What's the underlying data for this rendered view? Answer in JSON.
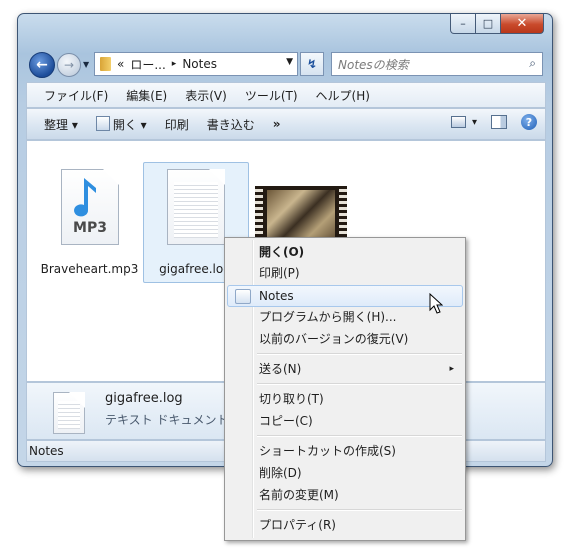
{
  "window": {
    "minimize": "–",
    "maximize": "□",
    "close": "✕"
  },
  "nav": {
    "back": "←",
    "forward": "→",
    "dropdown": "▼"
  },
  "address": {
    "chevrons": "«",
    "crumb1": "ロー...",
    "sep": "▸",
    "crumb2": "Notes",
    "drop": "▼"
  },
  "refresh": "↯",
  "search": {
    "placeholder": "Notesの検索",
    "icon": "⌕"
  },
  "menubar": [
    "ファイル(F)",
    "編集(E)",
    "表示(V)",
    "ツール(T)",
    "ヘルプ(H)"
  ],
  "toolbar": {
    "organize": "整理 ▾",
    "open": "開く ▾",
    "print": "印刷",
    "burn": "書き込む",
    "more": "»",
    "help": "?",
    "views_drop": "▾"
  },
  "files": [
    {
      "name": "Braveheart.mp3",
      "badge": "MP3"
    },
    {
      "name": "gigafree.log"
    }
  ],
  "details": {
    "name": "gigafree.log",
    "type": "テキスト ドキュメント"
  },
  "status": "Notes",
  "context_menu": {
    "open": "開く(O)",
    "print": "印刷(P)",
    "notes": "Notes",
    "open_with": "プログラムから開く(H)...",
    "restore": "以前のバージョンの復元(V)",
    "send_to": "送る(N)",
    "send_to_arrow": "▸",
    "cut": "切り取り(T)",
    "copy": "コピー(C)",
    "shortcut": "ショートカットの作成(S)",
    "delete": "削除(D)",
    "rename": "名前の変更(M)",
    "properties": "プロパティ(R)"
  }
}
